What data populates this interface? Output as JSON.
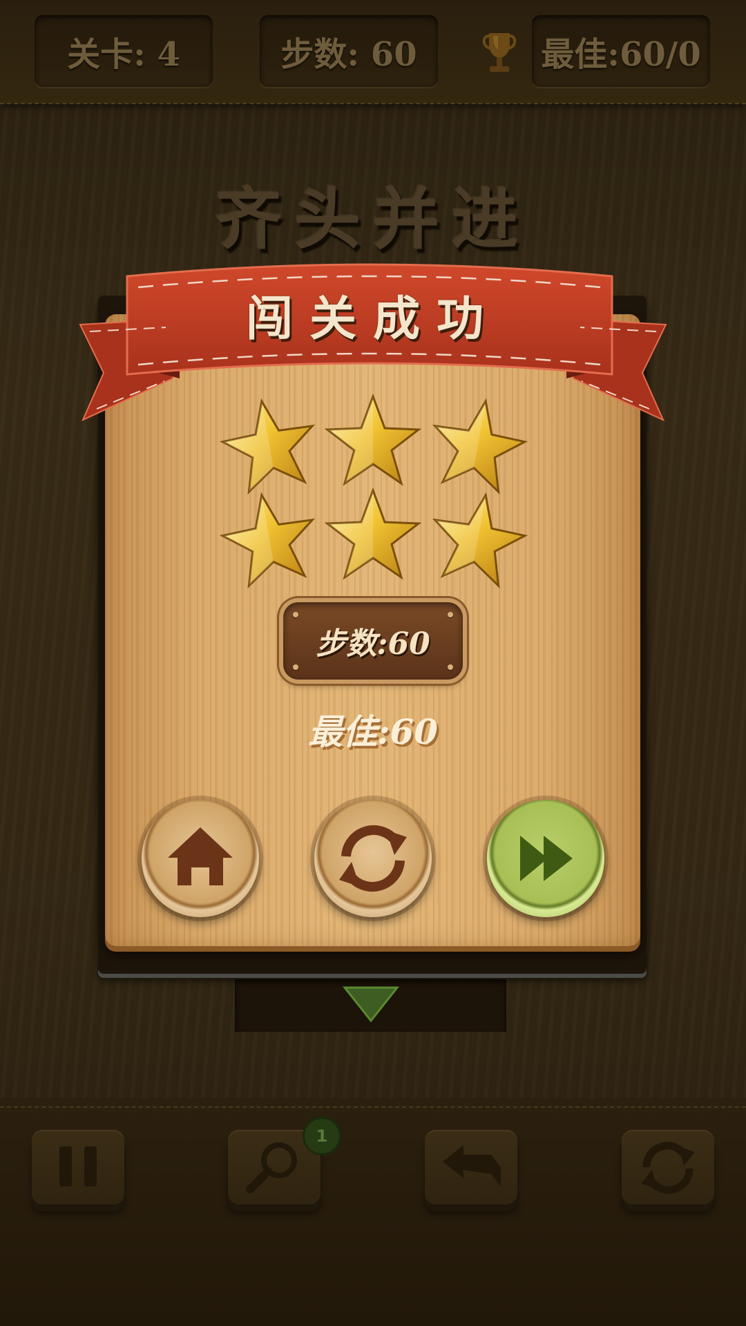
{
  "hud": {
    "level": "关卡: 4",
    "steps": "步数: 60",
    "best": "最佳:60/0"
  },
  "title": "齐头并进",
  "result": {
    "banner": "闯关成功",
    "stars_earned": 6,
    "stars_total": 6,
    "steps": "步数:60",
    "best": "最佳:60"
  },
  "buttons": {
    "home": "home-icon",
    "restart": "restart-icon",
    "next": "fast-forward-icon"
  },
  "toolbar": {
    "pause": "pause-icon",
    "hint": "magnifier-icon",
    "hint_count": "1",
    "undo": "undo-icon",
    "reset": "restart-icon"
  },
  "colors": {
    "banner_red": "#c23d24",
    "star_gold": "#f1c232",
    "next_green": "#a7bf55",
    "wood": "#e2b474"
  }
}
